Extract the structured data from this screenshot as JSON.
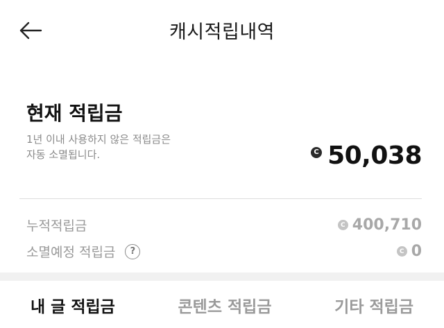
{
  "header": {
    "title": "캐시적립내역",
    "back_icon": "arrow-left-icon"
  },
  "balance": {
    "title": "현재 적립금",
    "notice_line1": "1년 이내 사용하지 않은 적립금은",
    "notice_line2": "자동 소멸됩니다.",
    "coin_symbol": "C",
    "amount": "50,038"
  },
  "summary": {
    "accumulated_label": "누적적립금",
    "accumulated_value": "400,710",
    "expiring_label": "소멸예정 적립금",
    "expiring_value": "0",
    "help_symbol": "?",
    "coin_symbol": "C"
  },
  "tabs": [
    {
      "label": "내 글 적립금",
      "active": true
    },
    {
      "label": "콘텐츠 적립금",
      "active": false
    },
    {
      "label": "기타 적립금",
      "active": false
    }
  ],
  "colors": {
    "primary_text": "#111111",
    "muted_text": "#999999",
    "divider": "#dddddd",
    "band": "#f1f1f1"
  }
}
